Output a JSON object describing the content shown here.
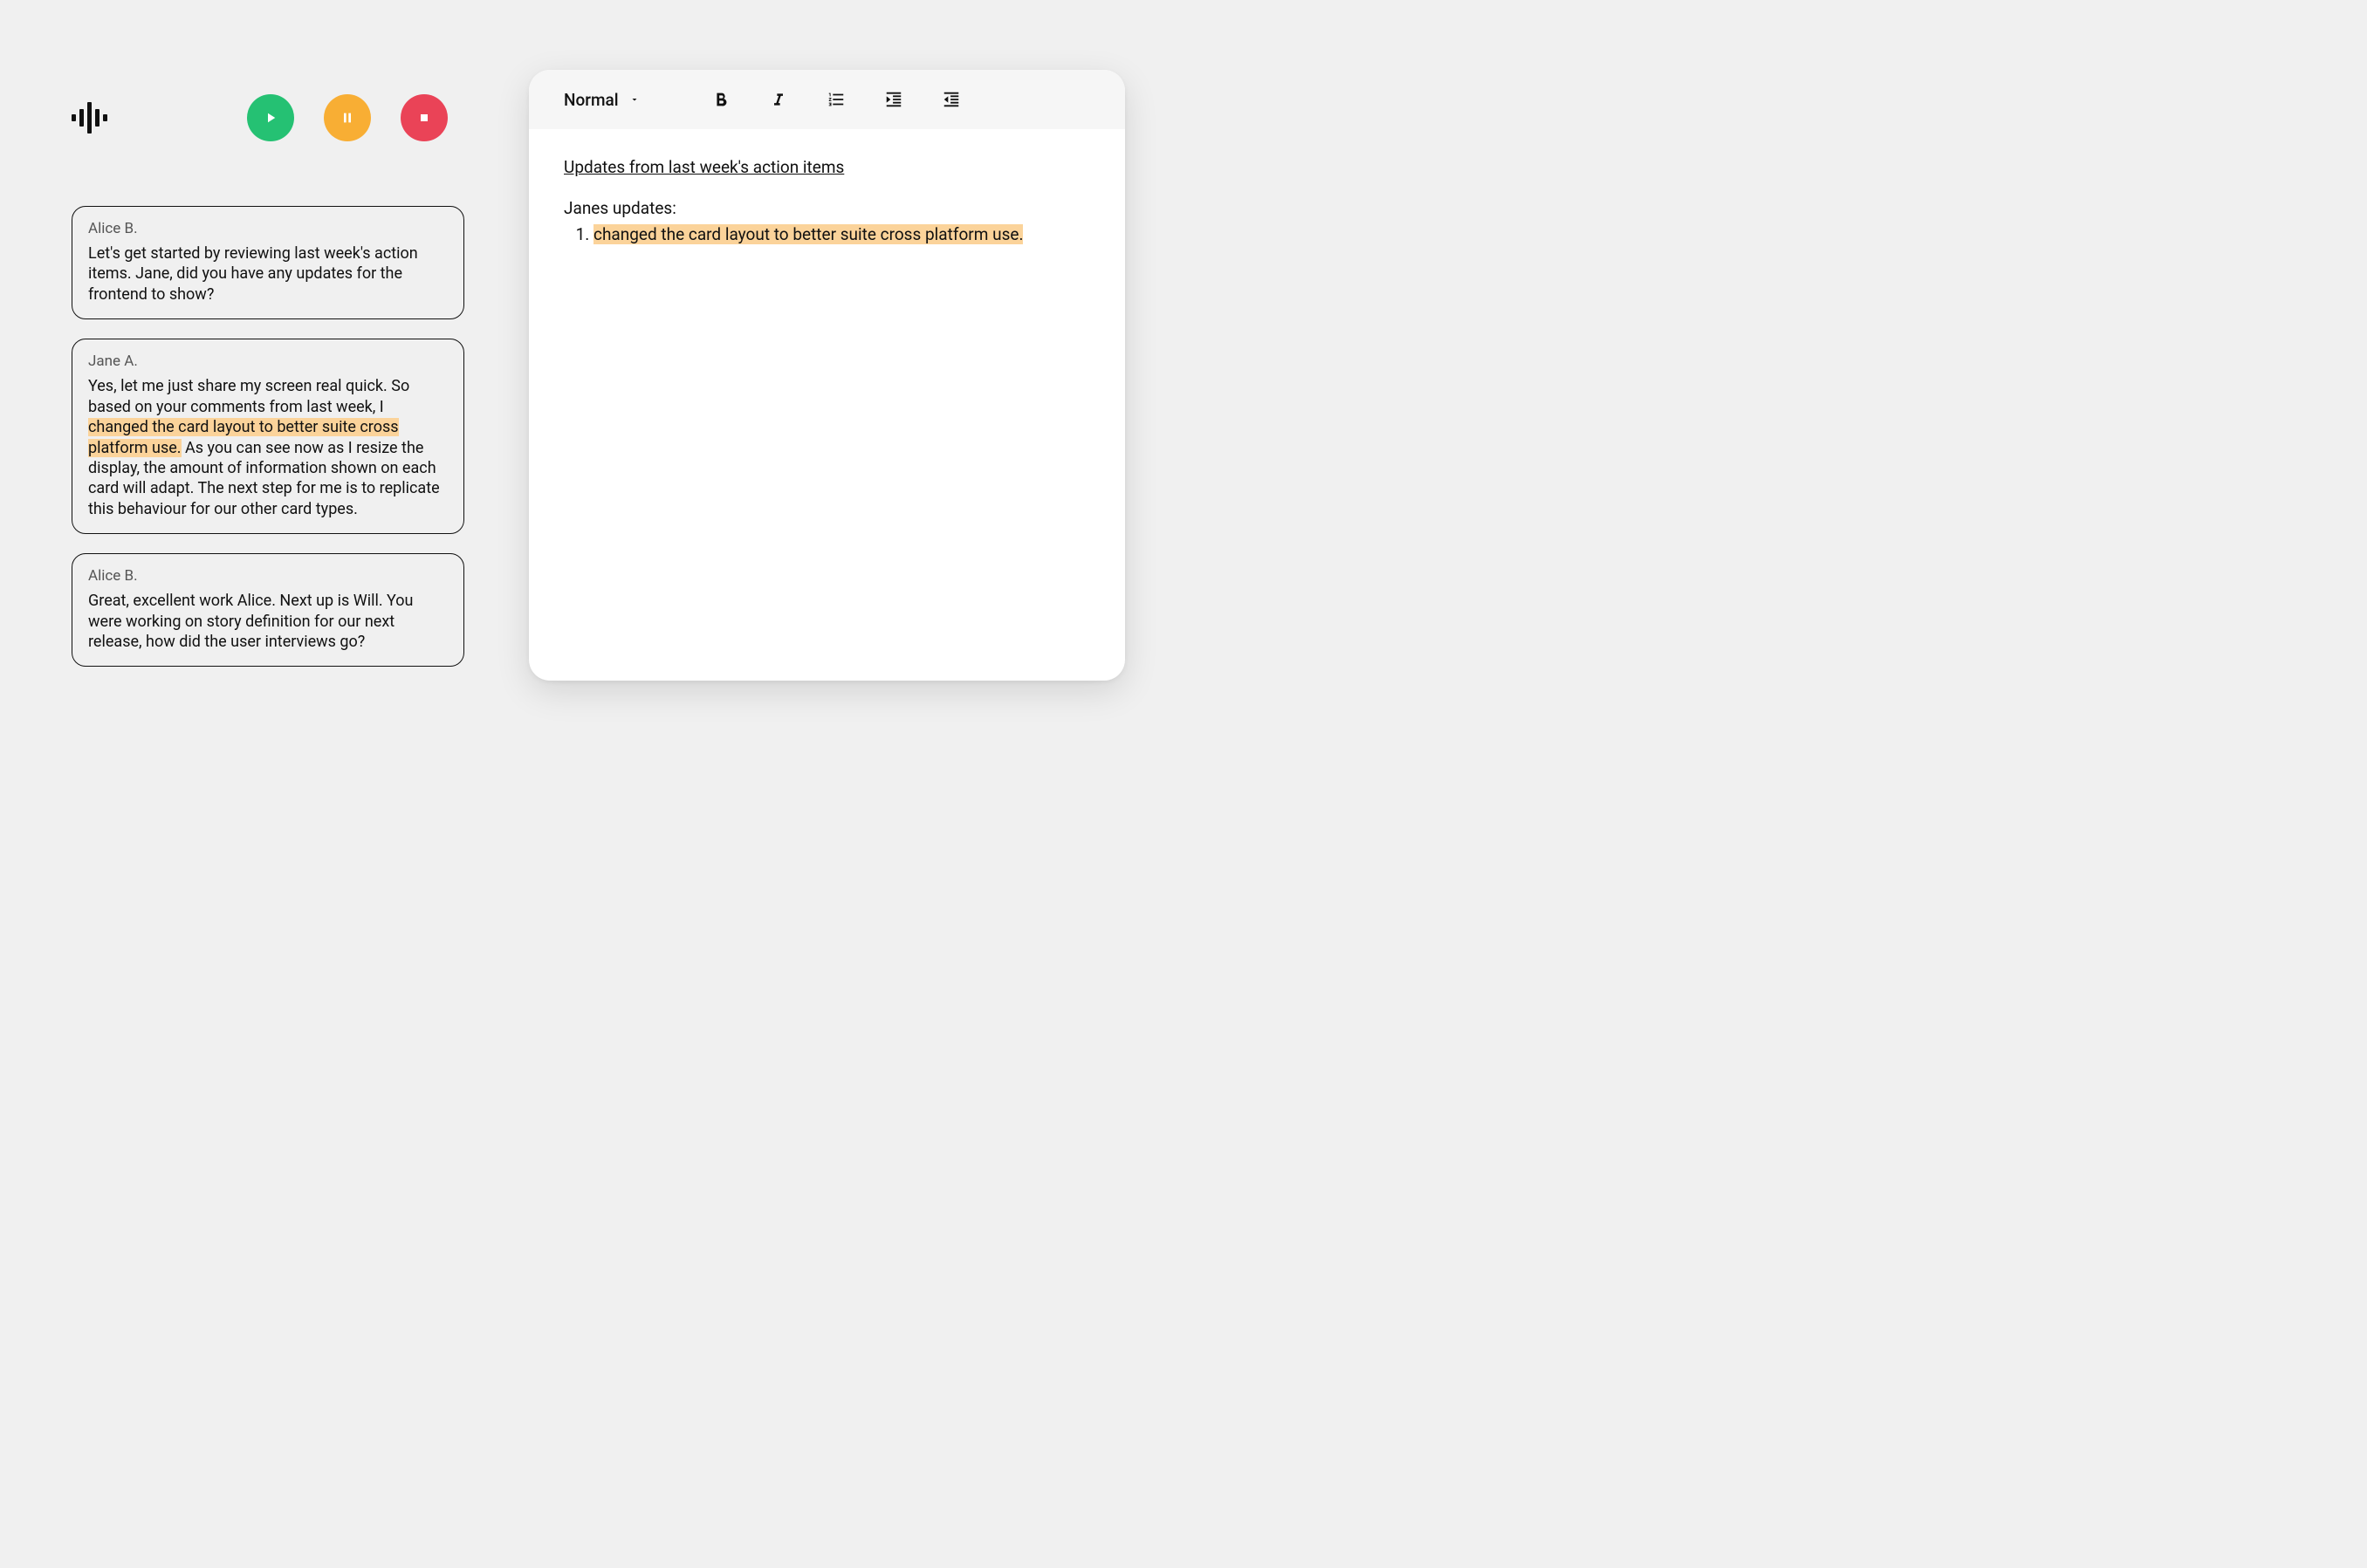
{
  "controls": {
    "play": "Play",
    "pause": "Pause",
    "stop": "Stop"
  },
  "transcript": [
    {
      "speaker": "Alice B.",
      "text_before": "Let's get started by reviewing last week's action items. Jane, did you have any updates for the frontend to show?",
      "highlight": "",
      "text_after": ""
    },
    {
      "speaker": "Jane A.",
      "text_before": "Yes, let me just share my screen real quick. So based on your comments from last week, I ",
      "highlight": "changed the card layout to better suite cross platform use.",
      "text_after": " As you can see now as I resize the display, the amount of information shown on each card will adapt. The next step for me is to replicate this behaviour for our other card types."
    },
    {
      "speaker": "Alice B.",
      "text_before": "Great, excellent work Alice. Next up is Will. You were working on story definition for our next release, how did the user interviews go?",
      "highlight": "",
      "text_after": ""
    }
  ],
  "editor": {
    "style_label": "Normal",
    "title": "Updates from last week's action items",
    "section_label": "Janes updates:",
    "items": [
      "changed the card layout to better suite cross platform use."
    ]
  }
}
